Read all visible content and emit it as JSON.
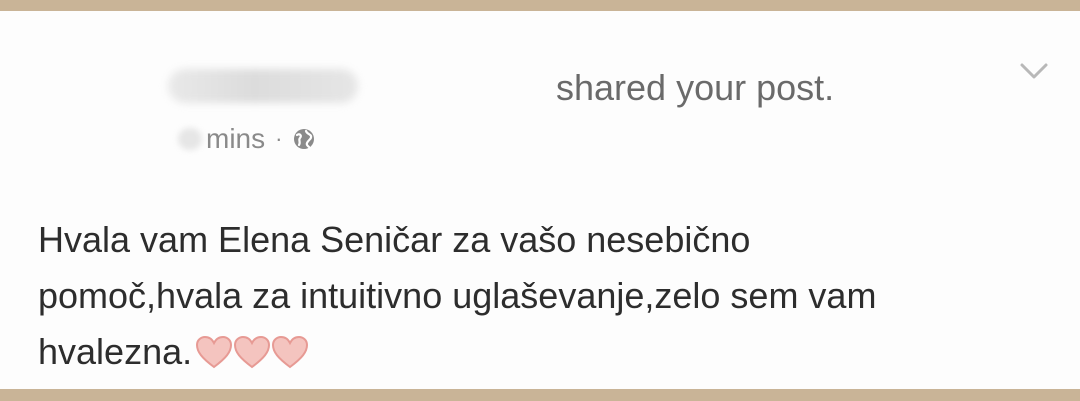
{
  "story": {
    "action_text": "shared your post.",
    "time_text": "mins",
    "separator": "·",
    "options_icon": "chevron-down-icon",
    "privacy_icon": "globe-icon"
  },
  "post": {
    "lines": [
      "Hvala vam Elena Seničar za vašo nesebično",
      "pomoč,hvala za intuitivno uglaševanje,zelo sem vam",
      "hvalezna."
    ],
    "emoji": [
      "heart",
      "heart",
      "heart"
    ]
  },
  "colors": {
    "background_border": "#c9b497",
    "card": "#fdfdfd",
    "heart": "#f2b5b0"
  }
}
